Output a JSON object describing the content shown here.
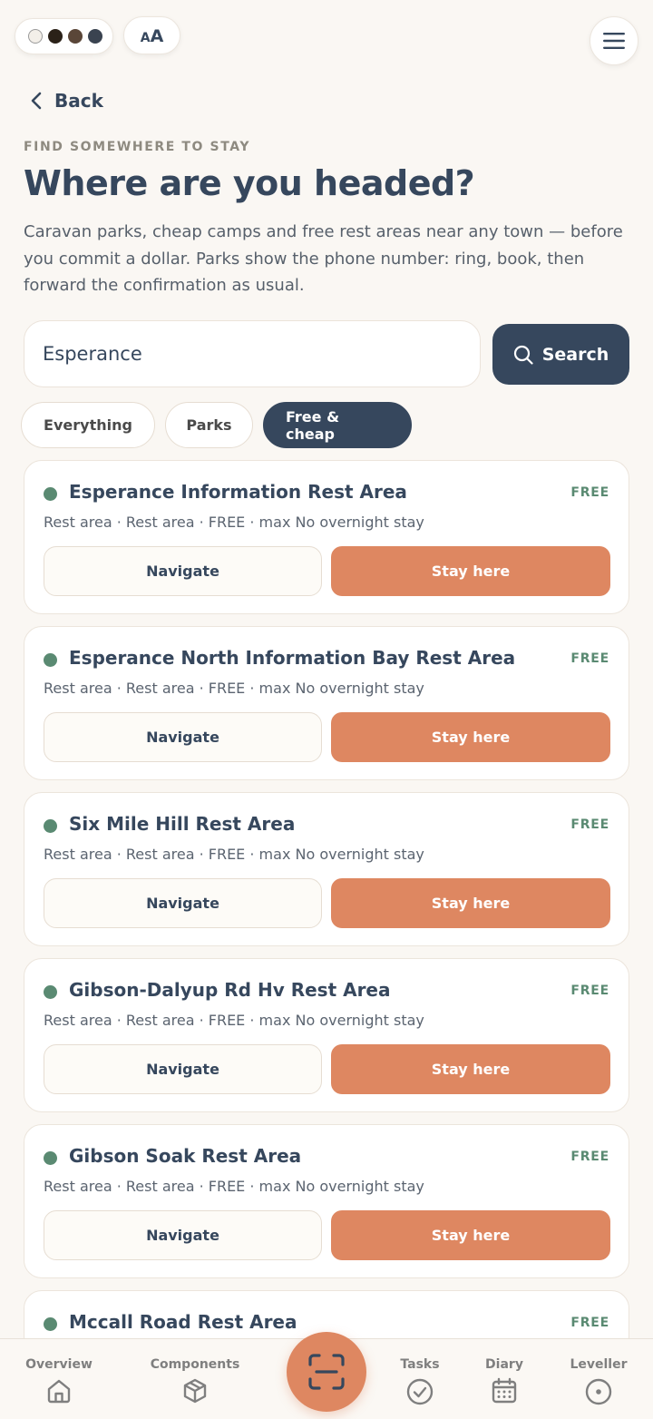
{
  "header": {
    "theme_swatch_colors": [
      "#f3efe9",
      "#2b2118",
      "#5a4638",
      "#3a4350"
    ],
    "text_size_small": "A",
    "text_size_large": "A",
    "menu_icon": "hamburger-icon"
  },
  "back_label": "Back",
  "eyebrow": "FIND SOMEWHERE TO STAY",
  "title": "Where are you headed?",
  "intro": "Caravan parks, cheap camps and free rest areas near any town — before you commit a dollar. Parks show the phone number: ring, book, then forward the confirmation as usual.",
  "search": {
    "value": "Esperance",
    "button_label": "Search"
  },
  "filters": [
    {
      "label": "Everything",
      "active": false
    },
    {
      "label": "Parks",
      "active": false
    },
    {
      "label": "Free & cheap",
      "active": true
    }
  ],
  "results": [
    {
      "name": "Esperance Information Rest Area",
      "price": "FREE",
      "meta": "Rest area · Rest area · FREE · max No overnight stay",
      "navigate": "Navigate",
      "stay": "Stay here"
    },
    {
      "name": "Esperance North Information Bay Rest Area",
      "price": "FREE",
      "meta": "Rest area · Rest area · FREE · max No overnight stay",
      "navigate": "Navigate",
      "stay": "Stay here"
    },
    {
      "name": "Six Mile Hill Rest Area",
      "price": "FREE",
      "meta": "Rest area · Rest area · FREE · max No overnight stay",
      "navigate": "Navigate",
      "stay": "Stay here"
    },
    {
      "name": "Gibson-Dalyup Rd Hv Rest Area",
      "price": "FREE",
      "meta": "Rest area · Rest area · FREE · max No overnight stay",
      "navigate": "Navigate",
      "stay": "Stay here"
    },
    {
      "name": "Gibson Soak Rest Area",
      "price": "FREE",
      "meta": "Rest area · Rest area · FREE · max No overnight stay",
      "navigate": "Navigate",
      "stay": "Stay here"
    },
    {
      "name": "Mccall Road Rest Area",
      "price": "FREE",
      "meta": "",
      "navigate": "",
      "stay": ""
    }
  ],
  "bottom_nav": {
    "overview": "Overview",
    "components": "Components",
    "tasks": "Tasks",
    "diary": "Diary",
    "leveller": "Leveller"
  },
  "colors": {
    "primary": "#36475d",
    "accent": "#de8761",
    "free_green": "#5a8a72",
    "background": "#faf7f3"
  }
}
